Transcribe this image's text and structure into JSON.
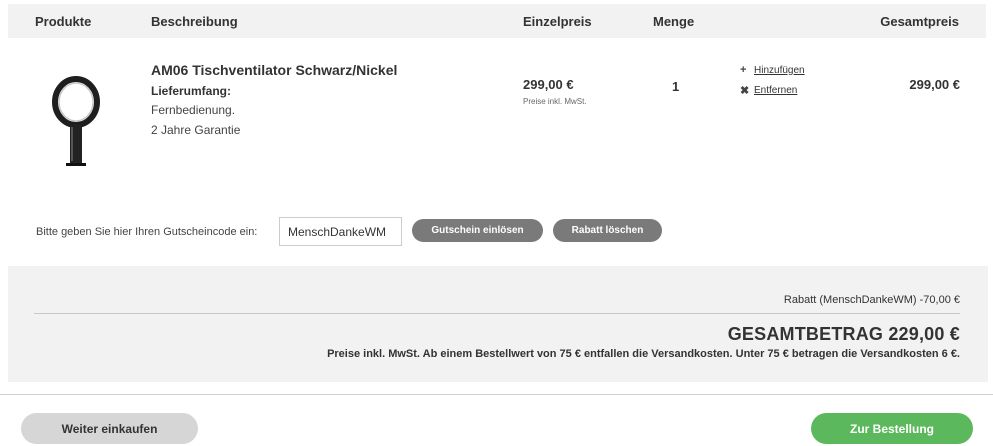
{
  "table_header": {
    "products": "Produkte",
    "description": "Beschreibung",
    "unit_price": "Einzelpreis",
    "quantity": "Menge",
    "total_price": "Gesamtpreis"
  },
  "item": {
    "name": "AM06 Tischventilator Schwarz/Nickel",
    "scope_label": "Lieferumfang:",
    "scope_items": [
      "Fernbedienung.",
      "2 Jahre Garantie"
    ],
    "unit_price": "299,00 €",
    "unit_price_note": "Preise inkl. MwSt.",
    "quantity": "1",
    "actions": {
      "add": "Hinzufügen",
      "remove": "Entfernen",
      "add_icon": "plus-icon",
      "remove_icon": "x-icon"
    },
    "line_total": "299,00 €",
    "image_icon": "fan-product-image"
  },
  "voucher": {
    "label": "Bitte geben Sie hier Ihren Gutscheincode ein:",
    "value": "MenschDankeWM",
    "redeem_button": "Gutschein einlösen",
    "clear_button": "Rabatt löschen"
  },
  "summary": {
    "discount_line": "Rabatt (MenschDankeWM)  -70,00 €",
    "total_line": "GESAMTBETRAG 229,00 €",
    "shipping_note": "Preise inkl. MwSt. Ab einem Bestellwert von 75 € entfallen die Versandkosten. Unter 75 € betragen die Versandkosten 6 €."
  },
  "footer": {
    "continue_button": "Weiter einkaufen",
    "order_button": "Zur Bestellung"
  },
  "colors": {
    "header_bg": "#f2f2f2",
    "button_gray": "#7a7a7a",
    "order_green": "#5cb85c"
  }
}
